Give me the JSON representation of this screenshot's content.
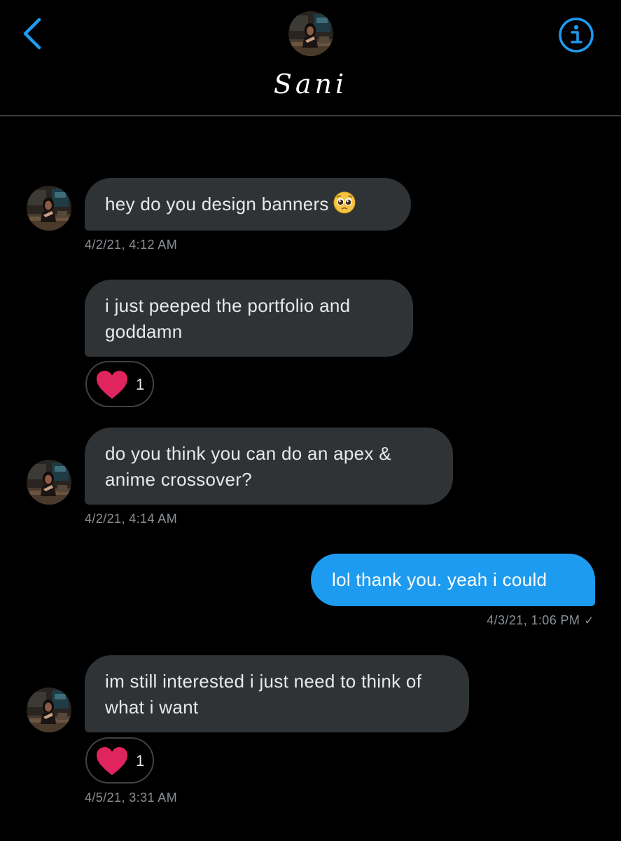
{
  "header": {
    "title": "Sani",
    "back_icon": "chevron-left-icon",
    "info_icon": "info-icon",
    "accent": "#1d9bf0"
  },
  "messages": [
    {
      "sender": "contact",
      "text": "hey do you design banners",
      "emoji": "pleading-face-emoji",
      "timestamp": "4/2/21, 4:12 AM"
    },
    {
      "sender": "contact",
      "text": "i just peeped the portfolio and goddamn",
      "reaction": {
        "icon": "heart-icon",
        "count": "1"
      }
    },
    {
      "sender": "contact",
      "text": "do you think you can do an apex & anime crossover?",
      "timestamp": "4/2/21, 4:14 AM"
    },
    {
      "sender": "me",
      "text": "lol thank you. yeah i could",
      "timestamp": "4/3/21, 1:06 PM",
      "status_icon": "checkmark-icon"
    },
    {
      "sender": "contact",
      "text": "im still interested i just need to think of what i want",
      "reaction": {
        "icon": "heart-icon",
        "count": "1"
      },
      "timestamp": "4/5/21, 3:31 AM"
    }
  ],
  "colors": {
    "background": "#000000",
    "received_bubble": "#2f3336",
    "sent_bubble": "#1d9bf0",
    "timestamp": "#8b9095",
    "heart": "#e0245e"
  }
}
